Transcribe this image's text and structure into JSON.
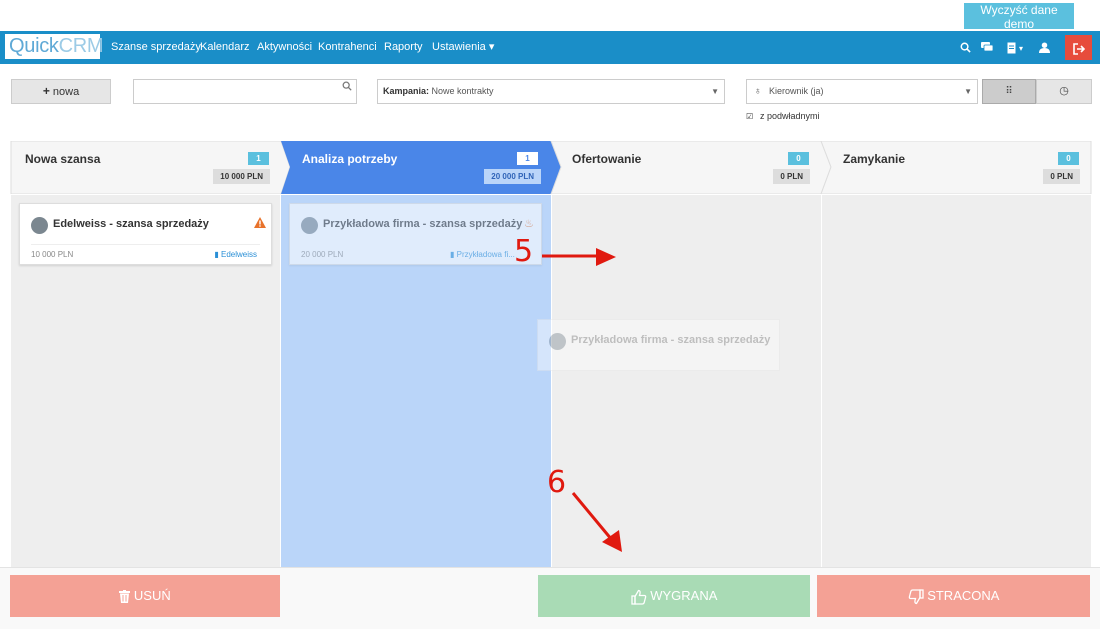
{
  "top_bar": {
    "demo_button": "Wyczyść dane demo"
  },
  "navbar": {
    "logo_quick": "Quick",
    "logo_crm": "CRM",
    "items": [
      {
        "label": "Szanse sprzedaży"
      },
      {
        "label": "Kalendarz"
      },
      {
        "label": "Aktywności"
      },
      {
        "label": "Kontrahenci"
      },
      {
        "label": "Raporty"
      },
      {
        "label": "Ustawienia ▾"
      }
    ],
    "icons": [
      "search-icon",
      "chat-icon",
      "document-icon",
      "user-icon",
      "logout-icon"
    ]
  },
  "toolbar": {
    "new_label": "nowa",
    "search_value": "",
    "campaign_label": "Kampania:",
    "campaign_value": "Nowe kontrakty",
    "manager_value": "Kierownik (ja)",
    "subordinates_label": "z podwładnymi",
    "subordinates_checked": true
  },
  "stages": [
    {
      "title": "Nowa szansa",
      "count": "1",
      "sum": "10 000 PLN"
    },
    {
      "title": "Analiza potrzeby",
      "count": "1",
      "sum": "20 000 PLN",
      "active": true
    },
    {
      "title": "Ofertowanie",
      "count": "0",
      "sum": "0 PLN"
    },
    {
      "title": "Zamykanie",
      "count": "0",
      "sum": "0 PLN"
    }
  ],
  "cards": [
    {
      "title": "Edelweiss - szansa sprzedaży",
      "amount": "10 000 PLN",
      "link": "Edelweiss",
      "icon": "warning-icon"
    },
    {
      "title": "Przykładowa firma - szansa sprzedaży",
      "amount": "20 000 PLN",
      "link": "Przykładowa fi...",
      "icon": "fire-icon"
    }
  ],
  "drag_ghost": {
    "title": "Przykładowa firma - szansa sprzedaży"
  },
  "annotations": [
    "5",
    "6"
  ],
  "bottom_actions": {
    "delete": "USUŃ",
    "won": "WYGRANA",
    "lost": "STRACONA"
  },
  "colors": {
    "navbar": "#1a8ec8",
    "active_stage": "#4a86e8",
    "delete": "#f4a195",
    "won": "#a9dbb5",
    "lost": "#f4a195",
    "badge": "#5bc0de",
    "annotation": "#e0190f"
  }
}
